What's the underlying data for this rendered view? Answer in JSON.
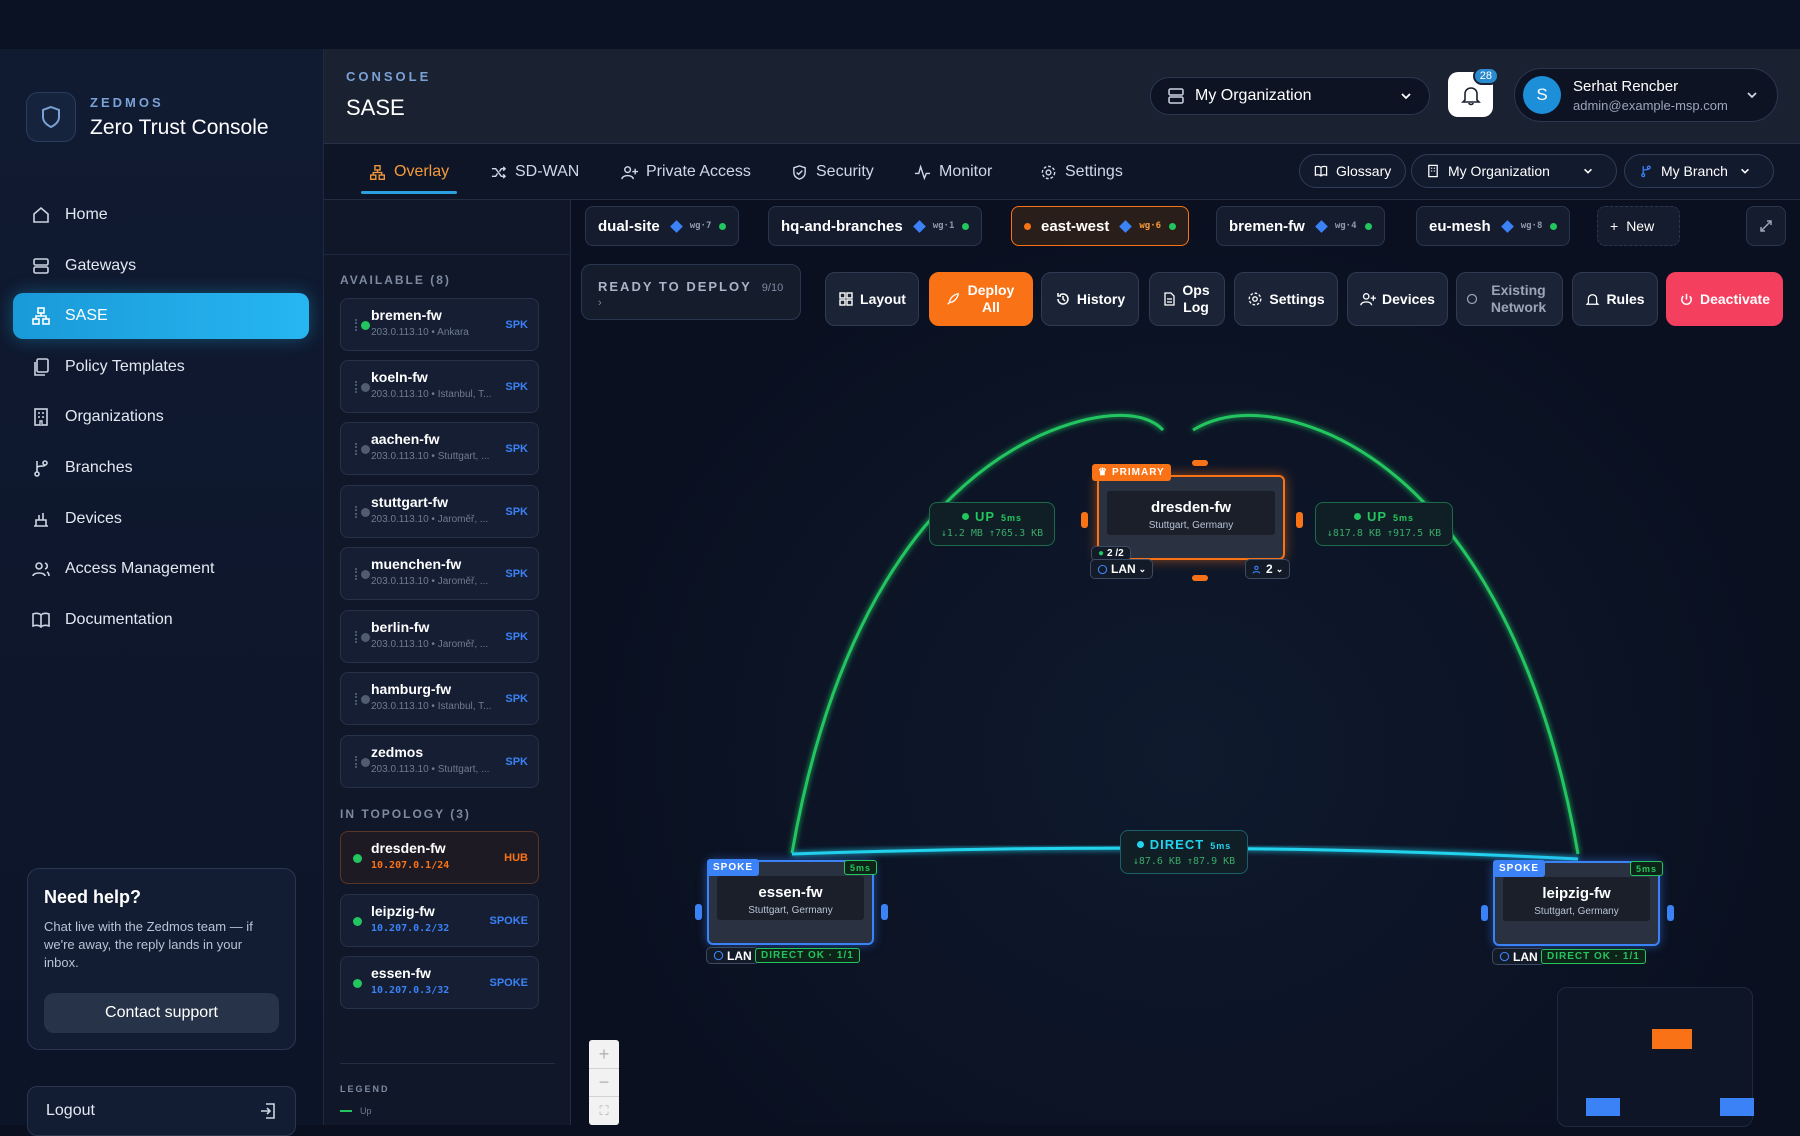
{
  "brand": {
    "sub": "ZEDMOS",
    "title": "Zero Trust Console"
  },
  "nav": [
    {
      "label": "Home",
      "icon": "home-icon"
    },
    {
      "label": "Gateways",
      "icon": "server-icon"
    },
    {
      "label": "SASE",
      "icon": "network-icon",
      "active": true
    },
    {
      "label": "Policy Templates",
      "icon": "copy-icon"
    },
    {
      "label": "Organizations",
      "icon": "building-icon"
    },
    {
      "label": "Branches",
      "icon": "branch-icon"
    },
    {
      "label": "Devices",
      "icon": "device-icon"
    },
    {
      "label": "Access Management",
      "icon": "users-icon"
    },
    {
      "label": "Documentation",
      "icon": "book-icon"
    }
  ],
  "help": {
    "title": "Need help?",
    "text": "Chat live with the Zedmos team — if we're away, the reply lands in your inbox.",
    "button": "Contact support"
  },
  "logout": "Logout",
  "header": {
    "sub": "CONSOLE",
    "title": "SASE",
    "org": "My Organization",
    "notifications": "28",
    "user_initial": "S",
    "user_name": "Serhat Rencber",
    "user_email": "admin@example-msp.com"
  },
  "tabs": [
    {
      "label": "Overlay",
      "active": true
    },
    {
      "label": "SD-WAN"
    },
    {
      "label": "Private Access"
    },
    {
      "label": "Security"
    },
    {
      "label": "Monitor"
    },
    {
      "label": "Settings"
    }
  ],
  "tabbar_right": {
    "glossary": "Glossary",
    "org": "My Organization",
    "branch": "My Branch"
  },
  "topologies": [
    {
      "name": "dual-site",
      "wg": "wg·7"
    },
    {
      "name": "hq-and-branches",
      "wg": "wg·1"
    },
    {
      "name": "east-west",
      "wg": "wg·6",
      "active": true
    },
    {
      "name": "bremen-fw",
      "wg": "wg·4"
    },
    {
      "name": "eu-mesh",
      "wg": "wg·8"
    }
  ],
  "new_topology": "New",
  "available": {
    "heading": "AVAILABLE (8)",
    "items": [
      {
        "name": "bremen-fw",
        "meta": "203.0.113.10 • Ankara",
        "role": "SPK",
        "online": true
      },
      {
        "name": "koeln-fw",
        "meta": "203.0.113.10 • Istanbul, T...",
        "role": "SPK"
      },
      {
        "name": "aachen-fw",
        "meta": "203.0.113.10 • Stuttgart, ...",
        "role": "SPK"
      },
      {
        "name": "stuttgart-fw",
        "meta": "203.0.113.10 • Jaroměř, ...",
        "role": "SPK"
      },
      {
        "name": "muenchen-fw",
        "meta": "203.0.113.10 • Jaroměř, ...",
        "role": "SPK"
      },
      {
        "name": "berlin-fw",
        "meta": "203.0.113.10 • Jaroměř, ...",
        "role": "SPK"
      },
      {
        "name": "hamburg-fw",
        "meta": "203.0.113.10 • Istanbul, T...",
        "role": "SPK"
      },
      {
        "name": "zedmos",
        "meta": "203.0.113.10 • Stuttgart, ...",
        "role": "SPK"
      }
    ]
  },
  "in_topology": {
    "heading": "IN TOPOLOGY (3)",
    "items": [
      {
        "name": "dresden-fw",
        "meta": "10.207.0.1/24",
        "role": "HUB"
      },
      {
        "name": "leipzig-fw",
        "meta": "10.207.0.2/32",
        "role": "SPOKE"
      },
      {
        "name": "essen-fw",
        "meta": "10.207.0.3/32",
        "role": "SPOKE"
      }
    ]
  },
  "legend": {
    "heading": "LEGEND",
    "up": "Up"
  },
  "toolbar": {
    "ready": "READY TO DEPLOY",
    "ready_count": "9/10 ›",
    "layout": "Layout",
    "deploy": "Deploy All",
    "history": "History",
    "opslog": "Ops Log",
    "settings": "Settings",
    "devices": "Devices",
    "existing": "Existing Network",
    "rules": "Rules",
    "deactivate": "Deactivate"
  },
  "graph": {
    "hub": {
      "name": "dresden-fw",
      "location": "Stuttgart, Germany",
      "badge": "PRIMARY",
      "lan": "LAN",
      "peers": "2 /2",
      "users": "2"
    },
    "spoke_left": {
      "name": "essen-fw",
      "location": "Stuttgart, Germany",
      "badge": "SPOKE",
      "latency": "5ms",
      "lan": "LAN",
      "status": "DIRECT OK · 1/1"
    },
    "spoke_right": {
      "name": "leipzig-fw",
      "location": "Stuttgart, Germany",
      "badge": "SPOKE",
      "latency": "5ms",
      "lan": "LAN",
      "status": "DIRECT OK · 1/1"
    },
    "link_left": {
      "state": "UP",
      "latency": "5ms",
      "traffic": "↓1.2 MB ↑765.3 KB"
    },
    "link_right": {
      "state": "UP",
      "latency": "5ms",
      "traffic": "↓817.8 KB ↑917.5 KB"
    },
    "link_direct": {
      "state": "DIRECT",
      "latency": "5ms",
      "traffic": "↓87.6 KB ↑87.9 KB"
    }
  },
  "colors": {
    "accent": "#26b6f2",
    "hub": "#f97316",
    "spoke": "#3b82f6",
    "up": "#22c55e",
    "direct": "#22d3ee",
    "danger": "#f43f5e"
  }
}
